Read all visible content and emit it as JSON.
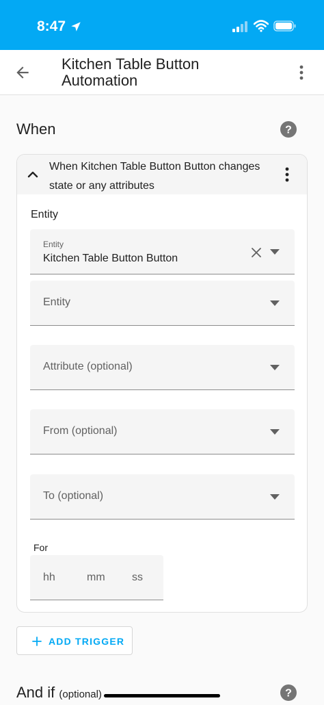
{
  "status_bar": {
    "time": "8:47",
    "icons": [
      "location-arrow-icon",
      "cellular-signal-icon",
      "wifi-icon",
      "battery-icon"
    ]
  },
  "app_bar": {
    "title_line1": "Kitchen Table Button",
    "title_line2": "Automation",
    "icons": [
      "back-arrow-icon",
      "more-vertical-icon"
    ]
  },
  "when_section": {
    "heading": "When",
    "help_icon": "help-circle-icon"
  },
  "trigger_card": {
    "header_line1": "When Kitchen Table Button Button changes",
    "header_line2": "state or any attributes",
    "entity_section_label": "Entity",
    "selected_entity": {
      "label": "Entity",
      "value": "Kitchen Table Button Button"
    },
    "fields": [
      {
        "placeholder": "Entity"
      },
      {
        "placeholder": "Attribute (optional)"
      },
      {
        "placeholder": "From (optional)"
      },
      {
        "placeholder": "To (optional)"
      }
    ],
    "for_label": "For",
    "duration": {
      "hours": "hh",
      "minutes": "mm",
      "seconds": "ss"
    }
  },
  "add_trigger_label": "ADD TRIGGER",
  "and_if_section": {
    "heading": "And if",
    "optional": "(optional)",
    "help_icon": "help-circle-icon"
  },
  "colors": {
    "accent": "#03a9f4",
    "field_bg": "#f5f5f5",
    "text_primary": "#212121",
    "text_secondary": "#616161"
  }
}
